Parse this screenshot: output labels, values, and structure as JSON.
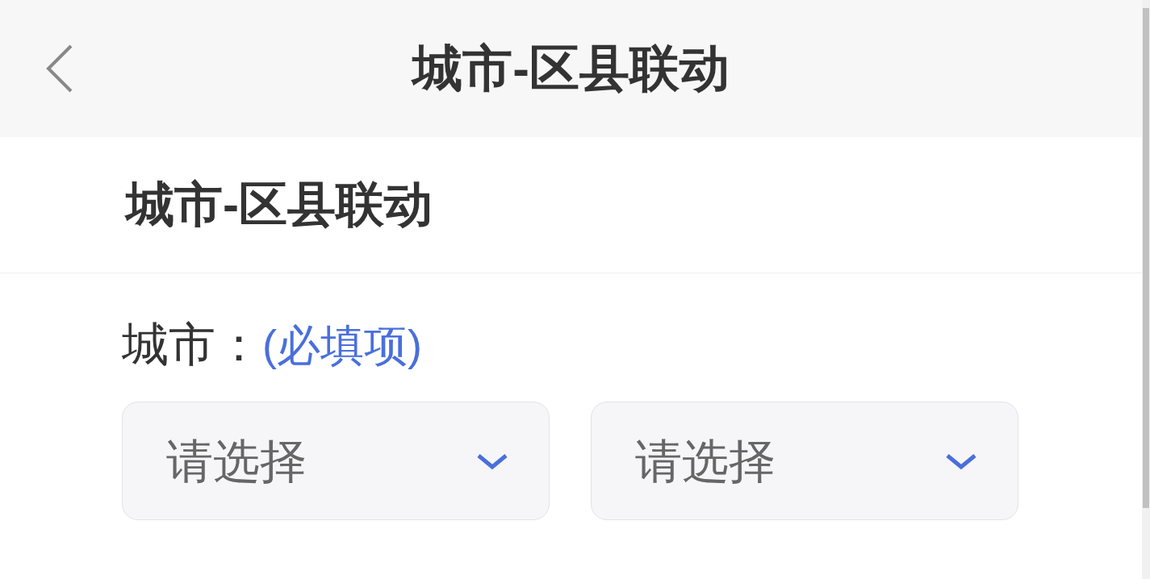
{
  "header": {
    "title": "城市-区县联动"
  },
  "section": {
    "title": "城市-区县联动"
  },
  "field": {
    "label": "城市：",
    "required_note": "(必填项)",
    "selects": [
      {
        "placeholder": "请选择"
      },
      {
        "placeholder": "请选择"
      }
    ]
  }
}
